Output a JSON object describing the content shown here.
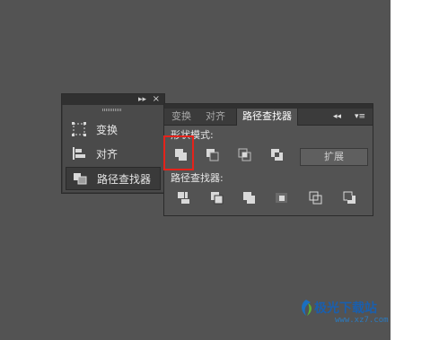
{
  "left_panel": {
    "items": [
      {
        "label": "变换",
        "icon": "transform-icon"
      },
      {
        "label": "对齐",
        "icon": "align-icon"
      },
      {
        "label": "路径查找器",
        "icon": "pathfinder-icon"
      }
    ],
    "title_controls": {
      "collapse": "▸▸",
      "close": "×"
    }
  },
  "pathfinder_panel": {
    "tabs": [
      {
        "label": "变换"
      },
      {
        "label": "对齐"
      },
      {
        "label": "路径查找器"
      }
    ],
    "active_tab": "路径查找器",
    "controls": {
      "collapse": "◂◂",
      "menu": "▾≡"
    },
    "shape_modes_label": "形状模式:",
    "shape_mode_buttons": [
      "unite-icon",
      "minus-front-icon",
      "intersect-icon",
      "exclude-icon"
    ],
    "expand_label": "扩展",
    "pathfinders_label": "路径查找器:",
    "pathfinder_buttons": [
      "divide-icon",
      "trim-icon",
      "merge-icon",
      "crop-icon",
      "outline-icon",
      "minus-back-icon"
    ]
  },
  "highlight_color": "#e5231b",
  "watermark": {
    "text": "极光下载站",
    "url": "www.xz7.com"
  }
}
